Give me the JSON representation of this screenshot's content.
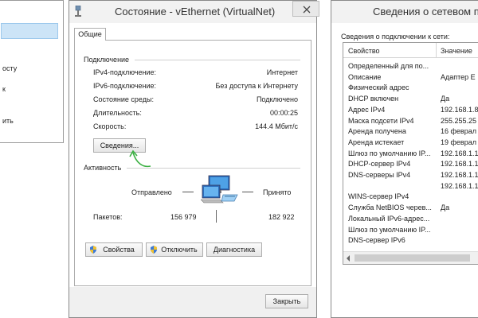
{
  "left_menu": {
    "items": [
      "",
      "осту",
      "к",
      "ить"
    ]
  },
  "status_window": {
    "title": "Состояние - vEthernet (VirtualNet)",
    "tab": "Общие",
    "connection_header": "Подключение",
    "connection_rows": [
      {
        "label": "IPv4-подключение:",
        "value": "Интернет"
      },
      {
        "label": "IPv6-подключение:",
        "value": "Без доступа к Интернету"
      },
      {
        "label": "Состояние среды:",
        "value": "Подключено"
      },
      {
        "label": "Длительность:",
        "value": "00:00:25"
      },
      {
        "label": "Скорость:",
        "value": "144.4 Мбит/с"
      }
    ],
    "details_button": "Сведения...",
    "activity_header": "Активность",
    "sent_label": "Отправлено",
    "received_label": "Принято",
    "packets_label": "Пакетов:",
    "packets_sent": "156 979",
    "packets_received": "182 922",
    "properties_button": "Свойства",
    "disable_button": "Отключить",
    "diagnose_button": "Диагностика",
    "close_button": "Закрыть"
  },
  "details_window": {
    "title": "Сведения о сетевом п",
    "subtitle": "Сведения о подключении к сети:",
    "col_property": "Свойство",
    "col_value": "Значение",
    "rows": [
      {
        "p": "Определенный для по...",
        "v": ""
      },
      {
        "p": "Описание",
        "v": "Адаптер Е"
      },
      {
        "p": "Физический адрес",
        "v": ""
      },
      {
        "p": "DHCP включен",
        "v": "Да"
      },
      {
        "p": "Адрес IPv4",
        "v": "192.168.1.8"
      },
      {
        "p": "Маска подсети IPv4",
        "v": "255.255.25"
      },
      {
        "p": "Аренда получена",
        "v": "16 феврал"
      },
      {
        "p": "Аренда истекает",
        "v": "19 феврал"
      },
      {
        "p": "Шлюз по умолчанию IP...",
        "v": "192.168.1.1"
      },
      {
        "p": "DHCP-сервер IPv4",
        "v": "192.168.1.1"
      },
      {
        "p": "DNS-серверы IPv4",
        "v": "192.168.1.1"
      },
      {
        "p": "",
        "v": "192.168.1.1"
      },
      {
        "p": "WINS-сервер IPv4",
        "v": ""
      },
      {
        "p": "Служба NetBIOS черев...",
        "v": "Да"
      },
      {
        "p": "Локальный IPv6-адрес...",
        "v": ""
      },
      {
        "p": "Шлюз по умолчанию IP...",
        "v": ""
      },
      {
        "p": "DNS-сервер IPv6",
        "v": ""
      }
    ]
  },
  "colors": {
    "accent_green": "#3cb043",
    "selection_blue": "#cce4f7",
    "border": "#8a8a8a"
  }
}
